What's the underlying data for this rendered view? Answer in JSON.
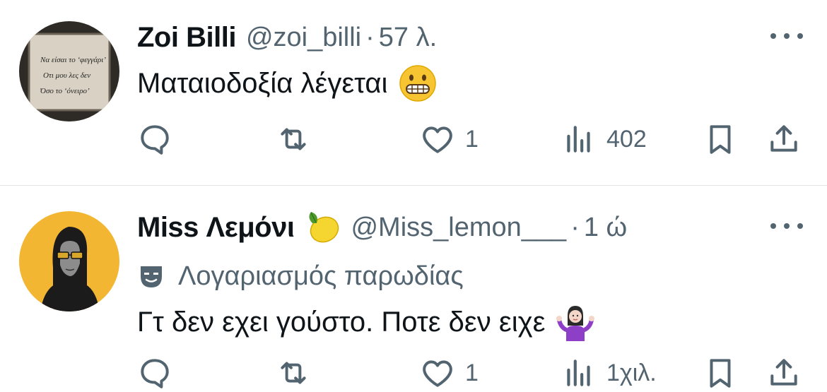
{
  "tweets": [
    {
      "name": "Zoi Billi",
      "handle": "@zoi_billi",
      "separator": "·",
      "time": "57 λ.",
      "text": "Ματαιοδοξία λέγεται",
      "text_emoji": "grimacing-face",
      "avatar_text": [
        "Να είσαι το ‘φεγγάρι’",
        "Οτι μου λες δεν",
        "Όσο το ‘όνειρο’"
      ],
      "actions": {
        "replies": "",
        "retweets": "",
        "likes": "1",
        "views": "402"
      }
    },
    {
      "name": "Miss Λεμόνι",
      "name_emoji": "lemon",
      "handle": "@Miss_lemon___",
      "separator": "·",
      "time": "1 ώ",
      "parody_label": "Λογαριασμός παρωδίας",
      "text": "Γτ δεν εχει γούστο. Ποτε δεν ειχε",
      "text_emoji": "woman-shrugging",
      "actions": {
        "replies": "",
        "retweets": "",
        "likes": "1",
        "views": "1χιλ."
      }
    }
  ],
  "colors": {
    "text": "#0f1419",
    "secondary": "#536471",
    "divider": "#e3e6e9",
    "avatar_bg": "#f2b633"
  }
}
